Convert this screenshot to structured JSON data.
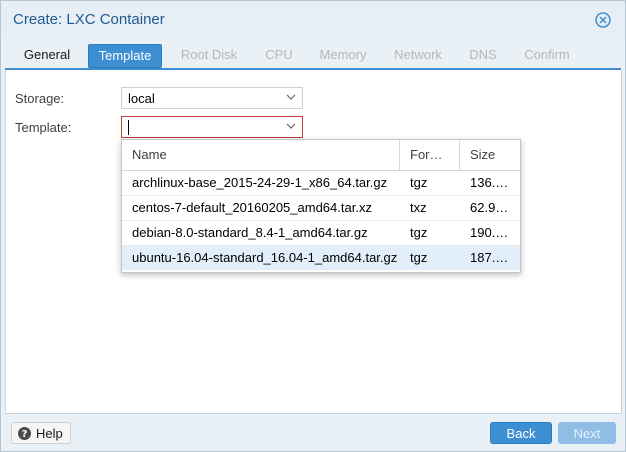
{
  "window": {
    "title": "Create: LXC Container"
  },
  "tabs": [
    {
      "label": "General",
      "state": "normal"
    },
    {
      "label": "Template",
      "state": "active"
    },
    {
      "label": "Root Disk",
      "state": "disabled"
    },
    {
      "label": "CPU",
      "state": "disabled"
    },
    {
      "label": "Memory",
      "state": "disabled"
    },
    {
      "label": "Network",
      "state": "disabled"
    },
    {
      "label": "DNS",
      "state": "disabled"
    },
    {
      "label": "Confirm",
      "state": "disabled"
    }
  ],
  "form": {
    "storage_label": "Storage:",
    "storage_value": "local",
    "template_label": "Template:",
    "template_value": ""
  },
  "picker": {
    "columns": [
      "Name",
      "For…",
      "Size"
    ],
    "rows": [
      {
        "name": "archlinux-base_2015-24-29-1_x86_64.tar.gz",
        "format": "tgz",
        "size": "136.…"
      },
      {
        "name": "centos-7-default_20160205_amd64.tar.xz",
        "format": "txz",
        "size": "62.9…"
      },
      {
        "name": "debian-8.0-standard_8.4-1_amd64.tar.gz",
        "format": "tgz",
        "size": "190.…"
      },
      {
        "name": "ubuntu-16.04-standard_16.04-1_amd64.tar.gz",
        "format": "tgz",
        "size": "187.…",
        "selected": true
      }
    ]
  },
  "footer": {
    "help_label": "Help",
    "back_label": "Back",
    "next_label": "Next"
  },
  "colors": {
    "accent": "#3d8fd1",
    "title": "#1e5a92",
    "invalid_border": "#c43b3b",
    "row_selected": "#e2eef9"
  },
  "icons": {
    "close": "close-icon",
    "help": "help-icon",
    "dropdown": "chevron-down-icon"
  }
}
